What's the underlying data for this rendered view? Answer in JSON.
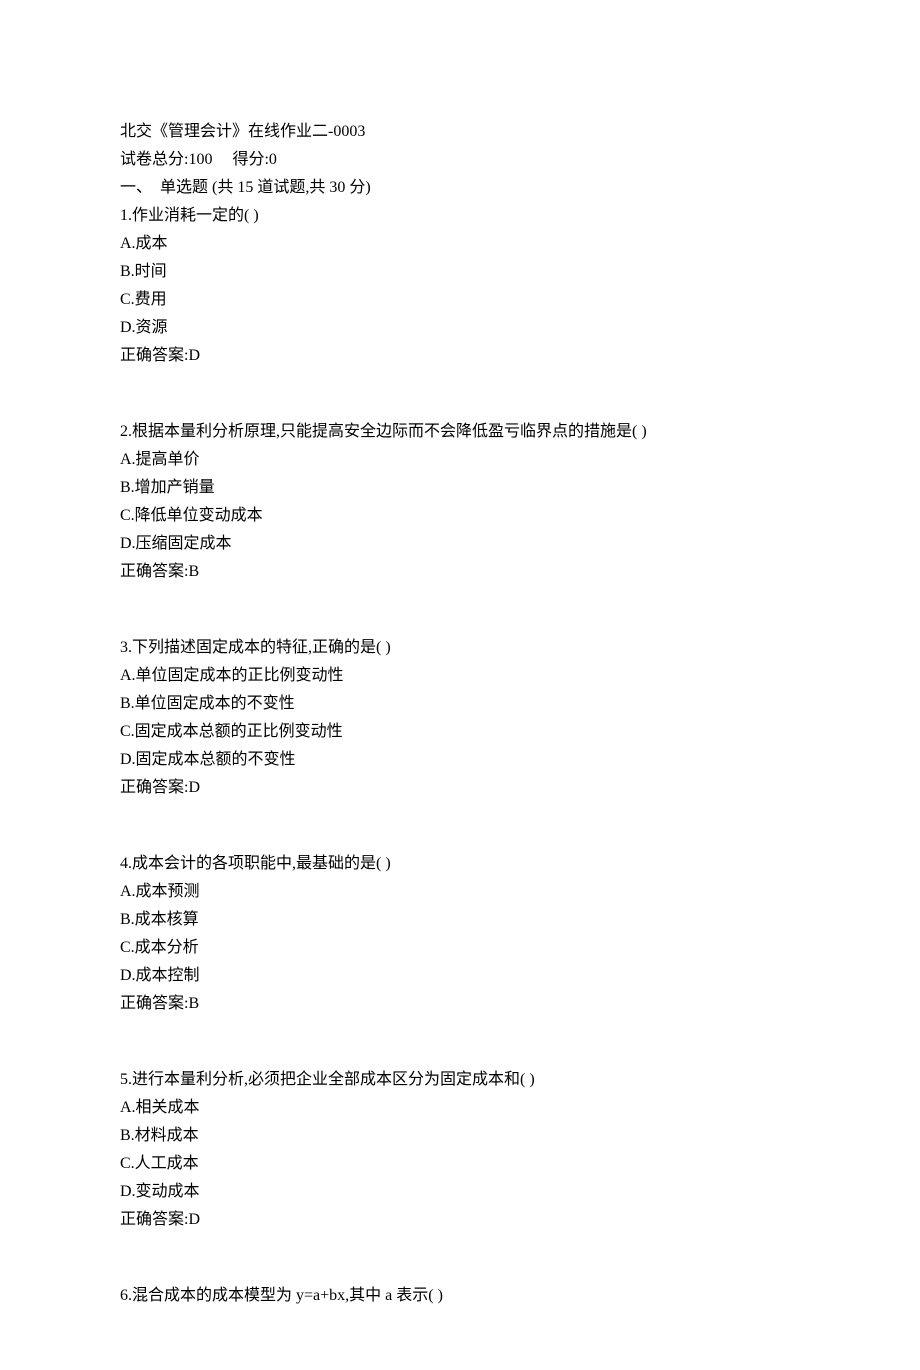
{
  "header": {
    "title": "北交《管理会计》在线作业二-0003",
    "totalScoreLabel": "试卷总分:100",
    "gotScoreLabel": "得分:0",
    "sectionHeader": "一、  单选题 (共 15 道试题,共 30 分)"
  },
  "questions": [
    {
      "stem": "1.作业消耗一定的( )",
      "options": [
        "A.成本",
        "B.时间",
        "C.费用",
        "D.资源"
      ],
      "answer": "正确答案:D"
    },
    {
      "stem": "2.根据本量利分析原理,只能提高安全边际而不会降低盈亏临界点的措施是( )",
      "options": [
        "A.提高单价",
        "B.增加产销量",
        "C.降低单位变动成本",
        "D.压缩固定成本"
      ],
      "answer": "正确答案:B"
    },
    {
      "stem": "3.下列描述固定成本的特征,正确的是( )",
      "options": [
        "A.单位固定成本的正比例变动性",
        "B.单位固定成本的不变性",
        "C.固定成本总额的正比例变动性",
        "D.固定成本总额的不变性"
      ],
      "answer": "正确答案:D"
    },
    {
      "stem": "4.成本会计的各项职能中,最基础的是( )",
      "options": [
        "A.成本预测",
        "B.成本核算",
        "C.成本分析",
        "D.成本控制"
      ],
      "answer": "正确答案:B"
    },
    {
      "stem": "5.进行本量利分析,必须把企业全部成本区分为固定成本和( )",
      "options": [
        "A.相关成本",
        "B.材料成本",
        "C.人工成本",
        "D.变动成本"
      ],
      "answer": "正确答案:D"
    },
    {
      "stem": "6.混合成本的成本模型为 y=a+bx,其中 a 表示( )",
      "options": [],
      "answer": ""
    }
  ]
}
